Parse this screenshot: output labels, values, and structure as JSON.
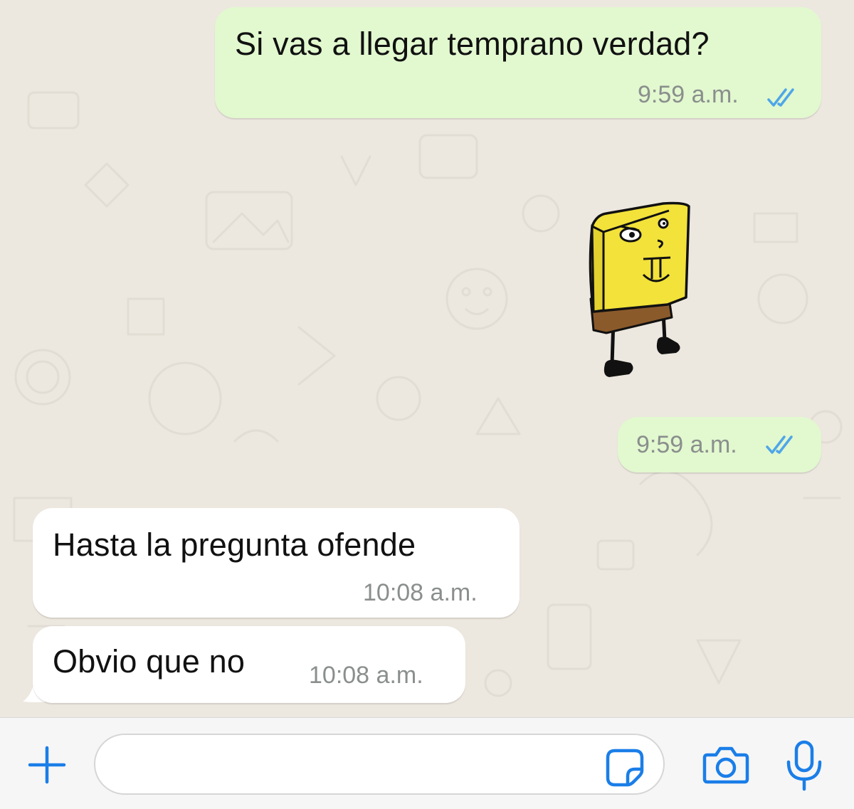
{
  "messages": [
    {
      "id": "m1",
      "direction": "outgoing",
      "kind": "text",
      "text": "Si vas a llegar temprano verdad?",
      "time": "9:59 a.m.",
      "status": "read"
    },
    {
      "id": "m2",
      "direction": "outgoing",
      "kind": "sticker",
      "sticker_icon": "spongebob-drawing-sticker",
      "time": "9:59 a.m.",
      "status": "read"
    },
    {
      "id": "m3",
      "direction": "incoming",
      "kind": "text",
      "text": "Hasta la pregunta ofende",
      "time": "10:08 a.m."
    },
    {
      "id": "m4",
      "direction": "incoming",
      "kind": "text",
      "text": "Obvio que no",
      "time": "10:08 a.m."
    }
  ],
  "composer": {
    "input_value": "",
    "placeholder": "",
    "icons": {
      "attach": "plus-icon",
      "sticker": "sticker-icon",
      "camera": "camera-icon",
      "mic": "microphone-icon"
    }
  },
  "colors": {
    "chat_background": "#ece7df",
    "outgoing_bubble": "#e2f8cf",
    "incoming_bubble": "#ffffff",
    "read_ticks": "#4fa6e8",
    "accent": "#1a7ee8",
    "timestamp": "#8a8f8d"
  }
}
